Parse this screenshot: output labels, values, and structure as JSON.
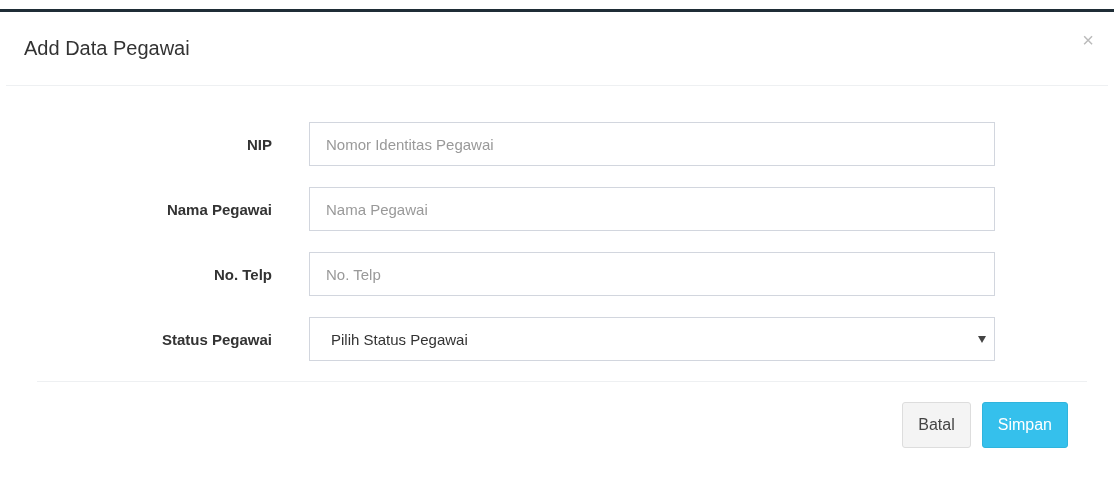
{
  "dialog": {
    "title": "Add Data Pegawai",
    "close": "×"
  },
  "fields": [
    {
      "label": "NIP",
      "kind": "text",
      "placeholder": "Nomor Identitas Pegawai"
    },
    {
      "label": "Nama Pegawai",
      "kind": "text",
      "placeholder": "Nama Pegawai"
    },
    {
      "label": "No. Telp",
      "kind": "text",
      "placeholder": "No. Telp"
    },
    {
      "label": "Status Pegawai",
      "kind": "select",
      "value": "Pilih Status Pegawai"
    }
  ],
  "buttons": [
    {
      "label": "Batal",
      "kind": "default"
    },
    {
      "label": "Simpan",
      "kind": "primary"
    }
  ]
}
